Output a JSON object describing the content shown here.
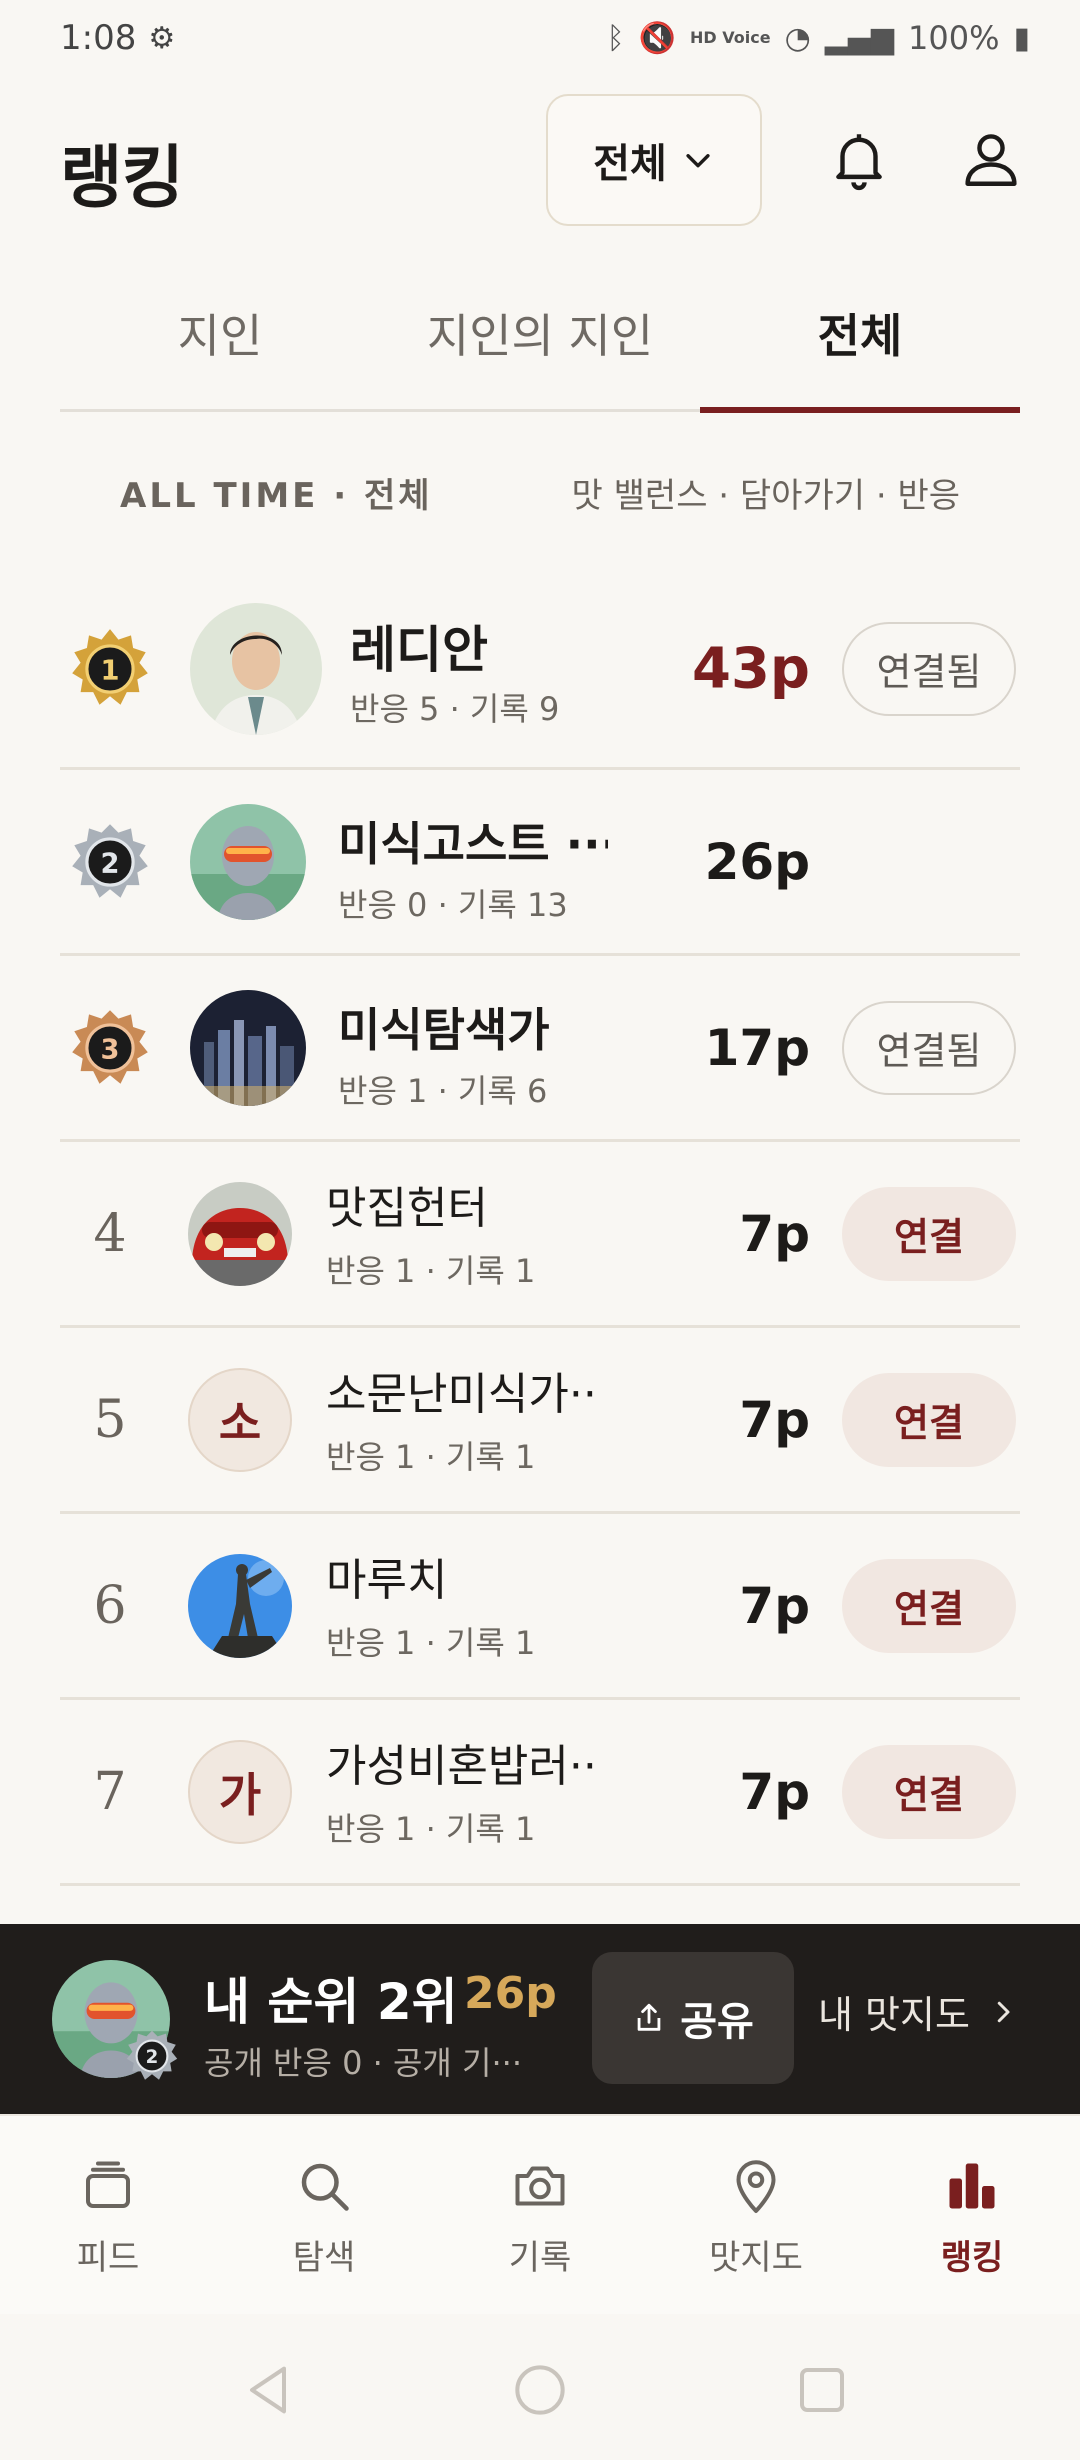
{
  "status_bar": {
    "time": "1:08",
    "battery": "100%",
    "network": "HD Voice"
  },
  "header": {
    "title": "랭킹",
    "scope_label": "전체"
  },
  "tabs": [
    {
      "label": "지인",
      "active": false
    },
    {
      "label": "지인의 지인",
      "active": false
    },
    {
      "label": "전체",
      "active": true
    }
  ],
  "filters": {
    "period": "ALL TIME · 전체",
    "criteria": "맛 밸런스 · 담아가기 · 반응"
  },
  "ranking": [
    {
      "rank": 1,
      "name": "레디안",
      "meta": "반응 5 · 기록 9",
      "points": "43p",
      "connection": "연결됨"
    },
    {
      "rank": 2,
      "name": "미식고스트 ···",
      "meta": "반응 0 · 기록 13",
      "points": "26p",
      "connection": ""
    },
    {
      "rank": 3,
      "name": "미식탐색가",
      "meta": "반응 1 · 기록 6",
      "points": "17p",
      "connection": "연결됨"
    },
    {
      "rank": "4",
      "name": "맛집헌터",
      "meta": "반응 1 · 기록 1",
      "points": "7p",
      "connection": "연결"
    },
    {
      "rank": "5",
      "name": "소문난미식가··",
      "meta": "반응 1 · 기록 1",
      "points": "7p",
      "connection": "연결",
      "avatar_letter": "소"
    },
    {
      "rank": "6",
      "name": "마루치",
      "meta": "반응 1 · 기록 1",
      "points": "7p",
      "connection": "연결"
    },
    {
      "rank": "7",
      "name": "가성비혼밥러··",
      "meta": "반응 1 · 기록 1",
      "points": "7p",
      "connection": "연결",
      "avatar_letter": "가"
    }
  ],
  "my_rank": {
    "title": "내 순위 2위",
    "points": "26p",
    "meta": "공개 반응 0 · 공개 기···",
    "badge": "2",
    "share_label": "공유",
    "map_label": "내 맛지도"
  },
  "nav": [
    {
      "label": "피드",
      "icon": "feed-icon",
      "active": false
    },
    {
      "label": "탐색",
      "icon": "search-icon",
      "active": false
    },
    {
      "label": "기록",
      "icon": "camera-icon",
      "active": false
    },
    {
      "label": "맛지도",
      "icon": "map-pin-icon",
      "active": false
    },
    {
      "label": "랭킹",
      "icon": "ranking-icon",
      "active": true
    }
  ],
  "colors": {
    "accent": "#7a1f1f",
    "gold": "#d6a85a",
    "background": "#f9f7f3",
    "dark_bar": "#201d1b"
  }
}
